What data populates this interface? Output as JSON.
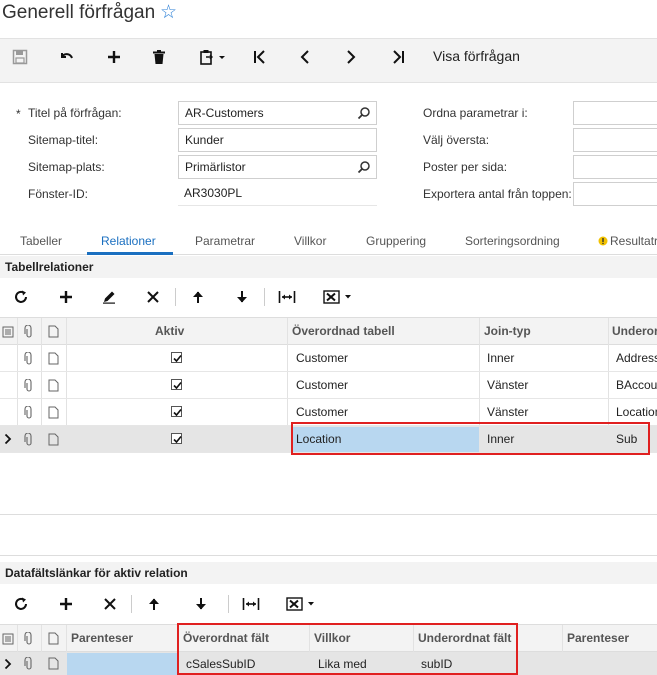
{
  "page": {
    "title": "Generell förfrågan"
  },
  "toolbar": {
    "view_query_label": "Visa förfrågan",
    "icons": [
      "save-icon",
      "undo-icon",
      "add-icon",
      "delete-icon",
      "paste-icon",
      "first-icon",
      "previous-icon",
      "next-icon",
      "last-icon"
    ]
  },
  "form": {
    "query_title_label": "Titel på förfrågan:",
    "query_title_value": "AR-Customers",
    "sitemap_title_label": "Sitemap-titel:",
    "sitemap_title_value": "Kunder",
    "sitemap_location_label": "Sitemap-plats:",
    "sitemap_location_value": "Primärlistor",
    "screen_id_label": "Fönster-ID:",
    "screen_id_value": "AR3030PL",
    "arrange_params_label": "Ordna parametrar i:",
    "select_top_label": "Välj översta:",
    "records_per_page_label": "Poster per sida:",
    "export_top_label": "Exportera antal från toppen:"
  },
  "tabs": [
    {
      "label": "Tabeller"
    },
    {
      "label": "Relationer"
    },
    {
      "label": "Parametrar"
    },
    {
      "label": "Villkor"
    },
    {
      "label": "Gruppering"
    },
    {
      "label": "Sorteringsordning"
    },
    {
      "label": "Resultatr"
    }
  ],
  "relations": {
    "section_title": "Tabellrelationer",
    "columns": {
      "active": "Aktiv",
      "parent_table": "Överordnad tabell",
      "join_type": "Join-typ",
      "child": "Underor"
    },
    "rows": [
      {
        "parent": "Customer",
        "join": "Inner",
        "child": "Address"
      },
      {
        "parent": "Customer",
        "join": "Vänster",
        "child": "BAccou"
      },
      {
        "parent": "Customer",
        "join": "Vänster",
        "child": "Location"
      },
      {
        "parent": "Location",
        "join": "Inner",
        "child": "Sub"
      }
    ]
  },
  "links": {
    "section_title": "Datafältslänkar för aktiv relation",
    "columns": {
      "brackets": "Parenteser",
      "parent_field": "Överordnat fält",
      "condition": "Villkor",
      "child_field": "Underordnat fält",
      "brackets2": "Parenteser"
    },
    "rows": [
      {
        "parent_field": "cSalesSubID",
        "condition": "Lika med",
        "child_field": "subID"
      }
    ]
  },
  "colors": {
    "accent": "#1a6fc0",
    "highlight_box": "#e02020",
    "selected_cell": "#b8d7f0"
  }
}
